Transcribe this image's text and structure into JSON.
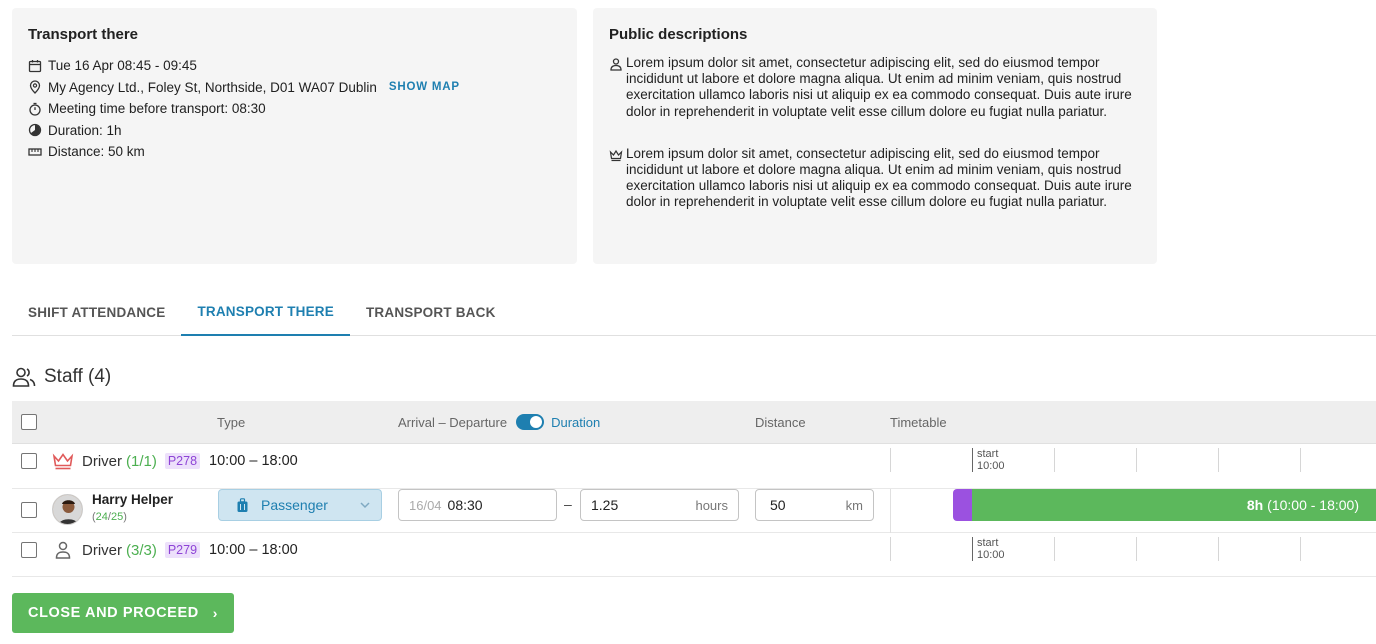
{
  "transport_card": {
    "title": "Transport there",
    "date_time": "Tue 16 Apr 08:45 - 09:45",
    "location": "My Agency Ltd., Foley St, Northside, D01 WA07 Dublin",
    "show_map_label": "SHOW MAP",
    "meeting_time": "Meeting time before transport: 08:30",
    "duration": "Duration: 1h",
    "distance": "Distance: 50 km"
  },
  "public_card": {
    "title": "Public descriptions",
    "descriptions": [
      {
        "icon": "person-icon",
        "text": "Lorem ipsum dolor sit amet, consectetur adipiscing elit, sed do eiusmod tempor incididunt ut labore et dolore magna aliqua. Ut enim ad minim veniam, quis nostrud exercitation ullamco laboris nisi ut aliquip ex ea commodo consequat. Duis aute irure dolor in reprehenderit in voluptate velit esse cillum dolore eu fugiat nulla pariatur."
      },
      {
        "icon": "crown-icon",
        "text": "Lorem ipsum dolor sit amet, consectetur adipiscing elit, sed do eiusmod tempor incididunt ut labore et dolore magna aliqua. Ut enim ad minim veniam, quis nostrud exercitation ullamco laboris nisi ut aliquip ex ea commodo consequat. Duis aute irure dolor in reprehenderit in voluptate velit esse cillum dolore eu fugiat nulla pariatur."
      }
    ]
  },
  "tabs": [
    {
      "label": "SHIFT ATTENDANCE",
      "active": false
    },
    {
      "label": "TRANSPORT THERE",
      "active": true
    },
    {
      "label": "TRANSPORT BACK",
      "active": false
    }
  ],
  "staff": {
    "title": "Staff (4)"
  },
  "table": {
    "headers": {
      "type": "Type",
      "arrival_departure": "Arrival – Departure",
      "duration_toggle": "Duration",
      "distance": "Distance",
      "timetable": "Timetable"
    },
    "duration_toggle_on": true,
    "groups": [
      {
        "role": "Driver",
        "count": "(1/1)",
        "badge": "P278",
        "time": "10:00 – 18:00",
        "timeline_start": "start",
        "timeline_start_time": "10:00"
      },
      {
        "role": "Driver",
        "count": "(3/3)",
        "badge": "P279",
        "time": "10:00 – 18:00",
        "timeline_start": "start",
        "timeline_start_time": "10:00"
      }
    ],
    "person": {
      "name": "Harry Helper",
      "score_a": "24",
      "score_b": "25",
      "type": "Passenger",
      "date_prefix": "16/04",
      "arrival_time": "08:30",
      "duration_value": "1.25",
      "duration_unit": "hours",
      "distance_value": "50",
      "distance_unit": "km",
      "timeline_hours": "8h",
      "timeline_range": "(10:00 - 18:00)"
    }
  },
  "actions": {
    "proceed_label": "CLOSE AND PROCEED",
    "proceed_arrow": "›"
  },
  "colors": {
    "accent": "#1e7fb0",
    "green": "#5cb85c",
    "purple": "#9b51e0",
    "crown_red": "#e05a5a"
  }
}
